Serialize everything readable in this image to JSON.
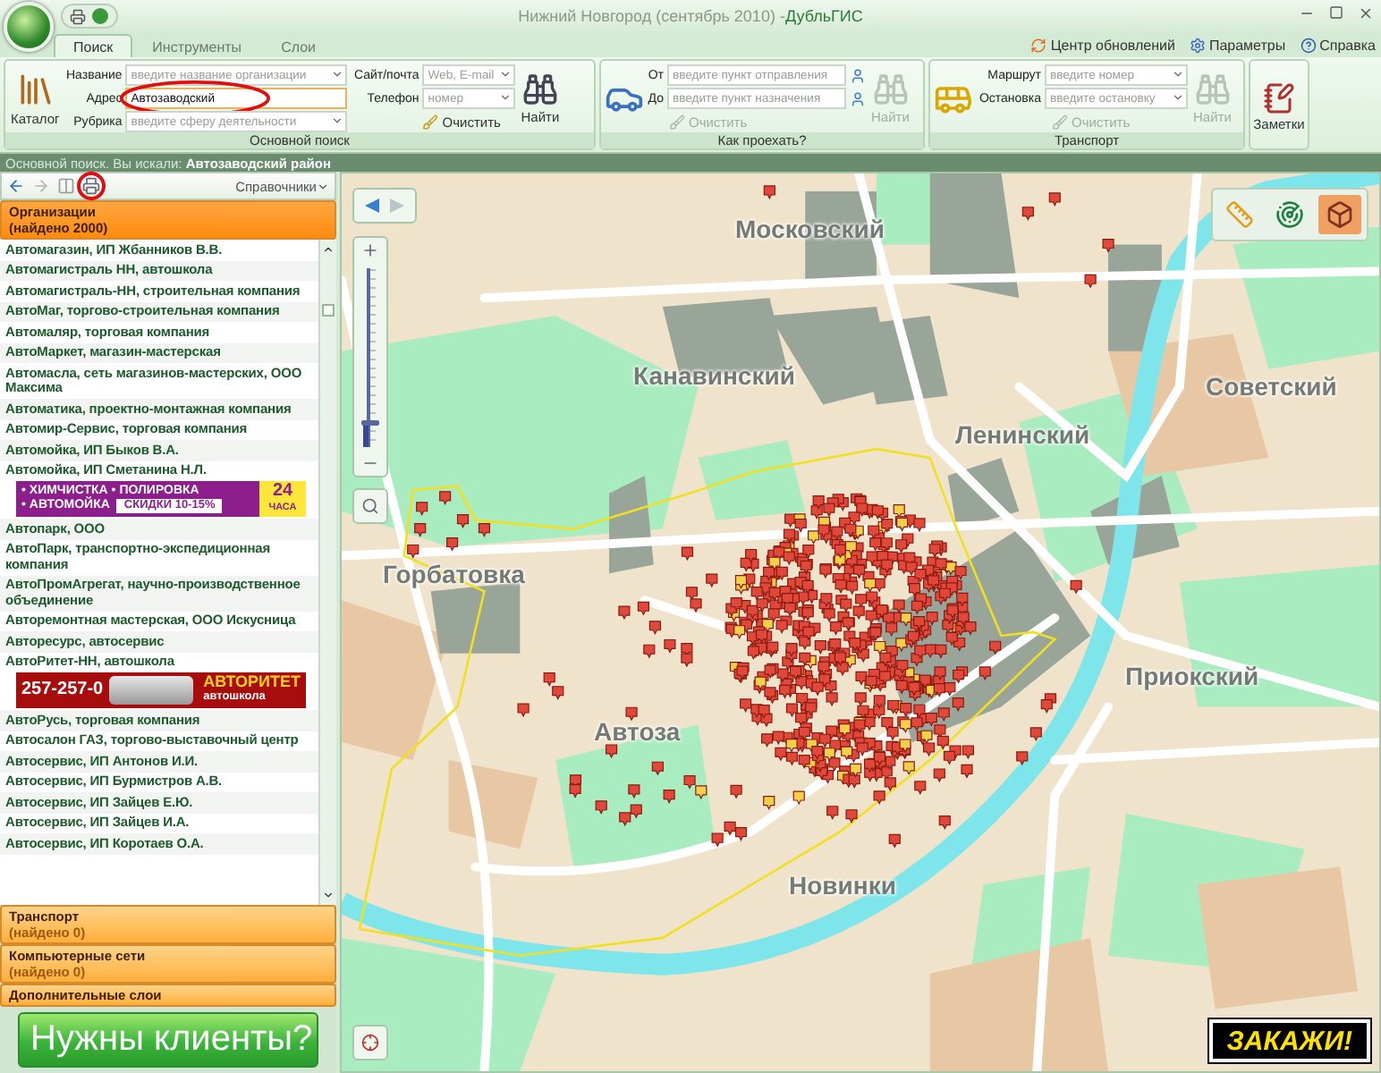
{
  "window": {
    "title": "Нижний Новгород (сентябрь 2010) - ",
    "app_name": "ДубльГИС"
  },
  "tabs": [
    {
      "label": "Поиск",
      "selected": true
    },
    {
      "label": "Инструменты",
      "selected": false
    },
    {
      "label": "Слои",
      "selected": false
    }
  ],
  "top_links": [
    "Центр обновлений",
    "Параметры",
    "Справка"
  ],
  "main_search": {
    "catalog_button": "Каталог",
    "title": "Основной поиск",
    "left_fields": [
      {
        "label": "Название",
        "placeholder": "введите название организации",
        "dropdown": true,
        "highlighted": false
      },
      {
        "label": "Адрес",
        "value": "Автозаводский",
        "dropdown": false,
        "highlighted": true
      },
      {
        "label": "Рубрика",
        "placeholder": "введите сферу деятельности",
        "dropdown": true,
        "highlighted": false
      }
    ],
    "right_fields": [
      {
        "label": "Сайт/почта",
        "placeholder": "Web, E-mail",
        "dropdown": true,
        "highlighted": false
      },
      {
        "label": "Телефон",
        "placeholder": "номер",
        "dropdown": true,
        "highlighted": false
      }
    ],
    "clear_button": {
      "label": "Очистить",
      "disabled": false
    },
    "find_button": {
      "label": "Найти",
      "disabled": false
    }
  },
  "route": {
    "title": "Как проехать?",
    "fields": [
      {
        "label": "От",
        "placeholder": "введите пункт отправления",
        "dropdown": false,
        "highlighted": false
      },
      {
        "label": "До",
        "placeholder": "введите пункт назначения",
        "dropdown": false,
        "highlighted": false
      }
    ],
    "clear_button": {
      "label": "Очистить",
      "disabled": true
    },
    "find_button": {
      "label": "Найти",
      "disabled": true
    }
  },
  "transport": {
    "title": "Транспорт",
    "fields": [
      {
        "label": "Маршрут",
        "placeholder": "введите номер",
        "dropdown": true,
        "highlighted": false
      },
      {
        "label": "Остановка",
        "placeholder": "введите остановку",
        "dropdown": true,
        "highlighted": false
      }
    ],
    "clear_button": {
      "label": "Очистить",
      "disabled": true
    },
    "find_button": {
      "label": "Найти",
      "disabled": true
    }
  },
  "notes_button": "Заметки",
  "status_bar": "Основной поиск. Вы искали: **Автозаводский район**",
  "left_toolbar": {
    "print_highlighted": true,
    "directory_menu": "Справочники"
  },
  "categories": [
    {
      "title": "Организации",
      "count": "(найдено 2000)",
      "expanded": true,
      "results": [
        {
          "name": "Автомагазин, ИП Жбанников В.В."
        },
        {
          "name": "Автомагистраль НН, автошкола"
        },
        {
          "name": "Автомагистраль-НН, строительная компания"
        },
        {
          "name": "АвтоМаг, торгово-строительная компания"
        },
        {
          "name": "Автомаляр, торговая компания"
        },
        {
          "name": "АвтоМаркет, магазин-мастерская"
        },
        {
          "name": "Автомасла, сеть магазинов-мастерских, ООО Максима"
        },
        {
          "name": "Автоматика, проектно-монтажная компания"
        },
        {
          "name": "Автомир-Сервис, торговая компания"
        },
        {
          "name": "Автомойка, ИП Быков В.А."
        },
        {
          "name": "Автомойка, ИП Сметанина Н.Л.",
          "ad": {
            "kind": "carwash",
            "texts": [
              "• ХИМЧИСТКА • ПОЛИРОВКА",
              "• АВТОМОЙКА",
              "СКИДКИ 10-15%",
              "24",
              "ЧАСА"
            ]
          }
        },
        {
          "name": "Автопарк, ООО"
        },
        {
          "name": "АвтоПарк, транспортно-экспедиционная компания"
        },
        {
          "name": "АвтоПромАгрегат, научно-производственное объединение"
        },
        {
          "name": "Авторемонтная мастерская, ООО Искусница"
        },
        {
          "name": "Авторесурс, автосервис"
        },
        {
          "name": "АвтоРитет-НН, автошкола",
          "ad": {
            "kind": "driving_school",
            "texts": [
              "257-257-0",
              "АВТОРИТЕТ",
              "автошкола"
            ]
          }
        },
        {
          "name": "АвтоРусь, торговая компания"
        },
        {
          "name": "Автосалон ГАЗ, торгово-выставочный центр"
        },
        {
          "name": "Автосервис, ИП Антонов И.И."
        },
        {
          "name": "Автосервис, ИП Бурмистров А.В."
        },
        {
          "name": "Автосервис, ИП Зайцев Е.Ю."
        },
        {
          "name": "Автосервис, ИП Зайцев И.А."
        },
        {
          "name": "Автосервис, ИП Коротаев О.А."
        }
      ]
    },
    {
      "title": "Транспорт",
      "count": "(найдено 0)",
      "expanded": false
    },
    {
      "title": "Компьютерные сети",
      "count": "(найдено 0)",
      "expanded": false
    },
    {
      "title": "Дополнительные слои",
      "expanded": false
    }
  ],
  "promo_button": "Нужны клиенты?",
  "map": {
    "zoom": {
      "level": 0.15
    },
    "labels": [
      "Московский",
      "Канавинский",
      "Ленинский",
      "Советский",
      "Горбатовка",
      "Приокский",
      "Автоза",
      "Новинки"
    ],
    "order_button": "ЗАКАЖИ!"
  }
}
